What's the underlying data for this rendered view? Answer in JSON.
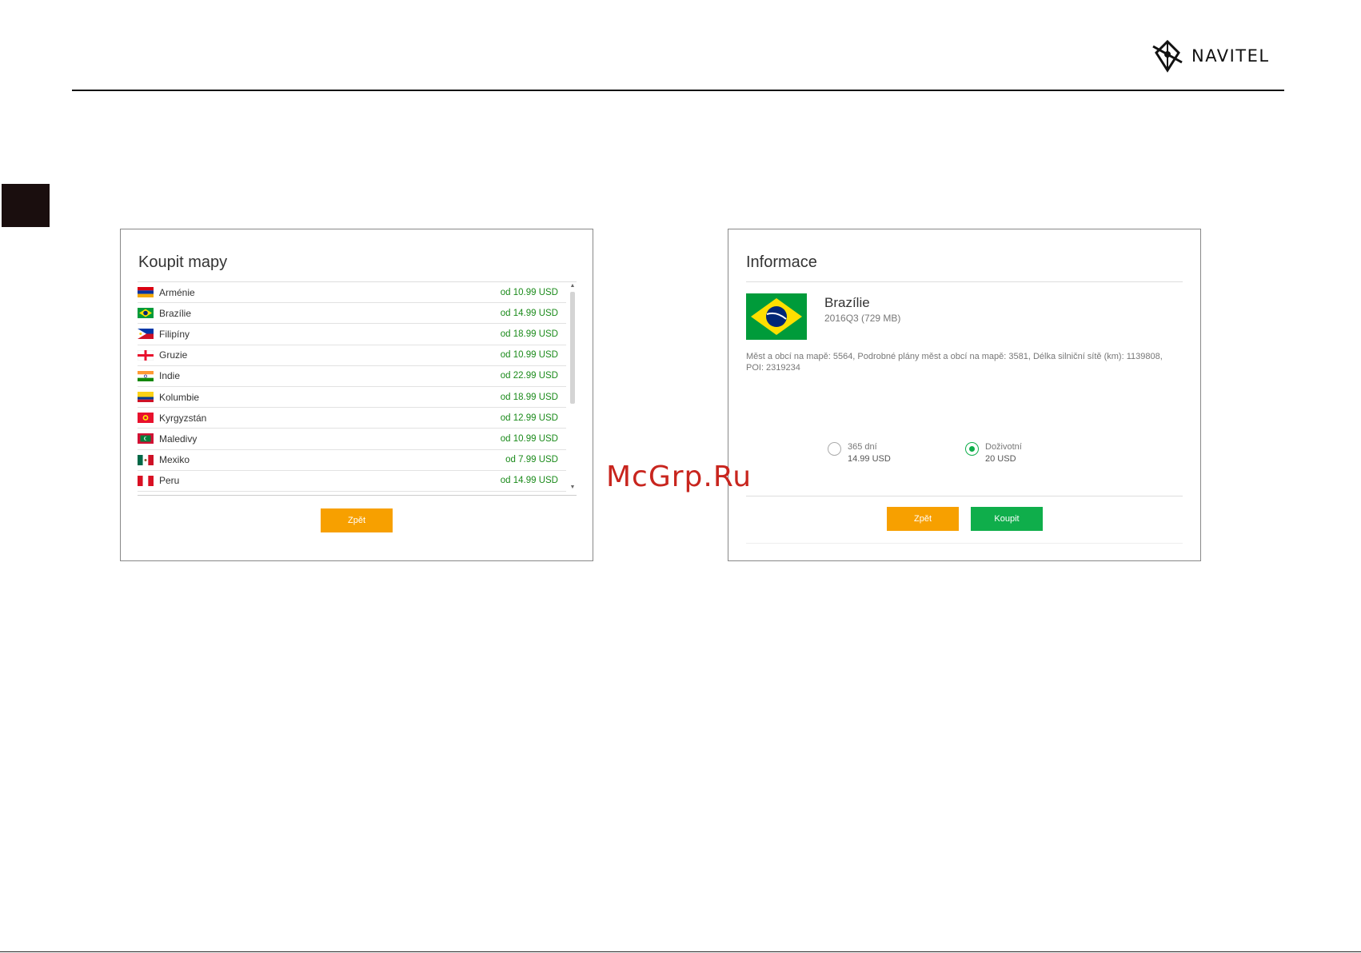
{
  "brand": {
    "name": "NAVITEL"
  },
  "watermark": "McGrp.Ru",
  "left_panel": {
    "title": "Koupit mapy",
    "back_label": "Zpět",
    "items": [
      {
        "name": "Arménie",
        "price": "od 10.99 USD",
        "flag": "armenia-flag"
      },
      {
        "name": "Brazílie",
        "price": "od 14.99 USD",
        "flag": "brazil-flag"
      },
      {
        "name": "Filipíny",
        "price": "od 18.99 USD",
        "flag": "philippines-flag"
      },
      {
        "name": "Gruzie",
        "price": "od 10.99 USD",
        "flag": "georgia-flag"
      },
      {
        "name": "Indie",
        "price": "od 22.99 USD",
        "flag": "india-flag"
      },
      {
        "name": "Kolumbie",
        "price": "od 18.99 USD",
        "flag": "colombia-flag"
      },
      {
        "name": "Kyrgyzstán",
        "price": "od 12.99 USD",
        "flag": "kyrgyzstan-flag"
      },
      {
        "name": "Maledivy",
        "price": "od 10.99 USD",
        "flag": "maldives-flag"
      },
      {
        "name": "Mexiko",
        "price": "od 7.99 USD",
        "flag": "mexico-flag"
      },
      {
        "name": "Peru",
        "price": "od 14.99 USD",
        "flag": "peru-flag"
      }
    ]
  },
  "right_panel": {
    "title": "Informace",
    "country": "Brazílie",
    "meta": "2016Q3 (729 MB)",
    "description": "Měst a obcí na mapě: 5564, Podrobné plány měst a obcí na mapě: 3581, Délka silniční sítě (km): 1139808, POI: 2319234",
    "options": [
      {
        "label": "365 dní",
        "price": "14.99 USD",
        "selected": false
      },
      {
        "label": "Doživotní",
        "price": "20 USD",
        "selected": true
      }
    ],
    "back_label": "Zpět",
    "buy_label": "Koupit"
  },
  "colors": {
    "accent_orange": "#f7a000",
    "accent_green": "#0fae4b",
    "price_green": "#1a8a1a"
  }
}
